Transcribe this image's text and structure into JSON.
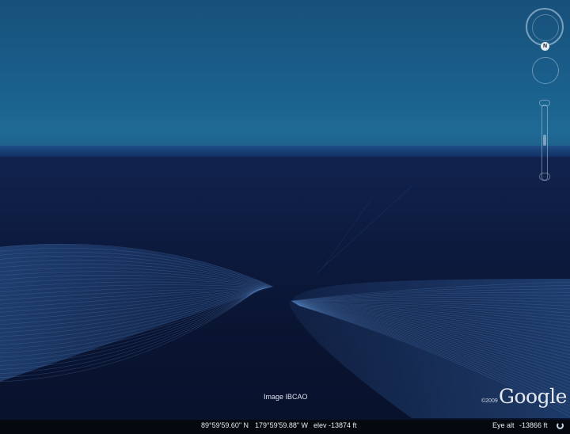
{
  "overlay": {
    "image_credit": "Image IBCAO",
    "logo_text": "Google",
    "copyright_year": "©2009"
  },
  "navigation": {
    "north_label": "N"
  },
  "status_bar": {
    "latitude": "89°59'59.60\" N",
    "longitude": "179°59'59.88\" W",
    "elevation": "elev -13874 ft",
    "eye_alt_label": "Eye alt",
    "eye_alt_value": "-13866 ft"
  },
  "colors": {
    "sky": "#1a5f8c",
    "ground": "#0a1533",
    "grid_lines": "#4a7ab8",
    "status_bar": "#06080f"
  }
}
